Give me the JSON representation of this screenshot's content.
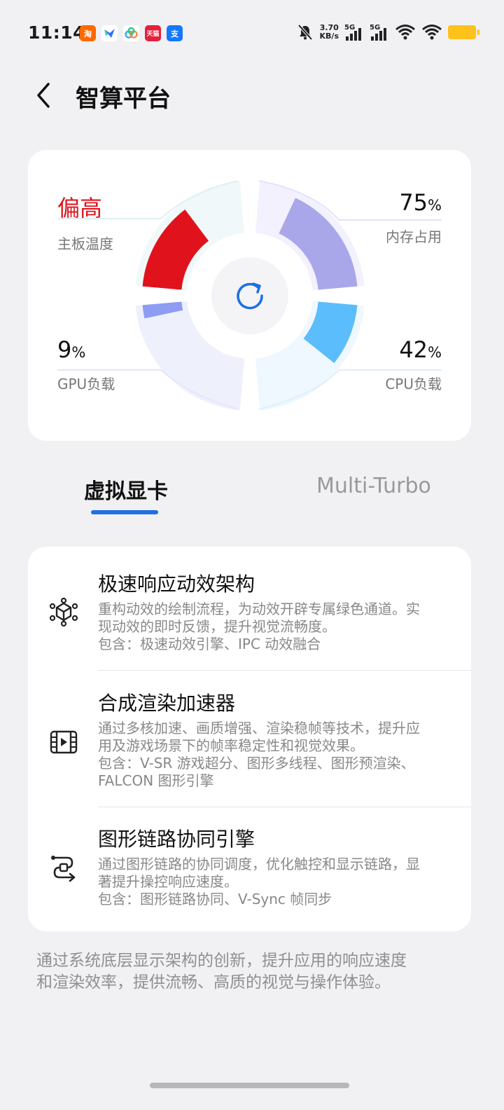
{
  "status_bar": {
    "time": "11:14",
    "app_icons": [
      {
        "name": "taobao",
        "label": "淘",
        "color": "#ff6a00"
      },
      {
        "name": "feishu",
        "label": "",
        "color": "#3370ff"
      },
      {
        "name": "baidu-netdisk",
        "label": "",
        "color": "#38a8f5"
      },
      {
        "name": "tmall",
        "label": "天猫",
        "color": "#e4203c"
      },
      {
        "name": "alipay",
        "label": "支",
        "color": "#1677ff"
      }
    ],
    "net_speed_value": "3.70",
    "net_speed_unit": "KB/s",
    "sim1_label": "5G",
    "sim2_label": "5G",
    "battery_color": "#ffc21a"
  },
  "header": {
    "title": "智算平台"
  },
  "status_card": {
    "board_temp": {
      "value": "偏高",
      "label": "主板温度",
      "color": "#e0121b"
    },
    "memory": {
      "value": "75",
      "unit": "%",
      "label": "内存占用",
      "percent": 75,
      "color": "#a9a7ea"
    },
    "gpu": {
      "value": "9",
      "unit": "%",
      "label": "GPU负载",
      "percent": 9,
      "color": "#8d9df3"
    },
    "cpu": {
      "value": "42",
      "unit": "%",
      "label": "CPU负载",
      "percent": 42,
      "color": "#5bbdfb"
    },
    "refresh_icon": "refresh-icon",
    "accent": "#1f6fe5"
  },
  "tabs": [
    {
      "label": "虚拟显卡",
      "active": true
    },
    {
      "label": "Multi-Turbo",
      "active": false
    }
  ],
  "features": [
    {
      "icon": "cube-network-icon",
      "title": "极速响应动效架构",
      "desc_lines": [
        "重构动效的绘制流程，为动效开辟专属绿色通道。实",
        "现动效的即时反馈，提升视觉流畅度。",
        "包含：极速动效引擎、IPC 动效融合"
      ]
    },
    {
      "icon": "film-icon",
      "title": "合成渲染加速器",
      "desc_lines": [
        "通过多核加速、画质增强、渲染稳帧等技术，提升应",
        "用及游戏场景下的帧率稳定性和视觉效果。",
        "包含：V-SR 游戏超分、图形多线程、图形预渲染、",
        "FALCON 图形引擎"
      ]
    },
    {
      "icon": "link-route-icon",
      "title": "图形链路协同引擎",
      "desc_lines": [
        "通过图形链路的协同调度，优化触控和显示链路，显",
        "著提升操控响应速度。",
        "包含：图形链路协同、V-Sync 帧同步"
      ]
    }
  ],
  "footer_note_lines": [
    "通过系统底层显示架构的创新，提升应用的响应速度",
    "和渲染效率，提供流畅、高质的视觉与操作体验。"
  ]
}
